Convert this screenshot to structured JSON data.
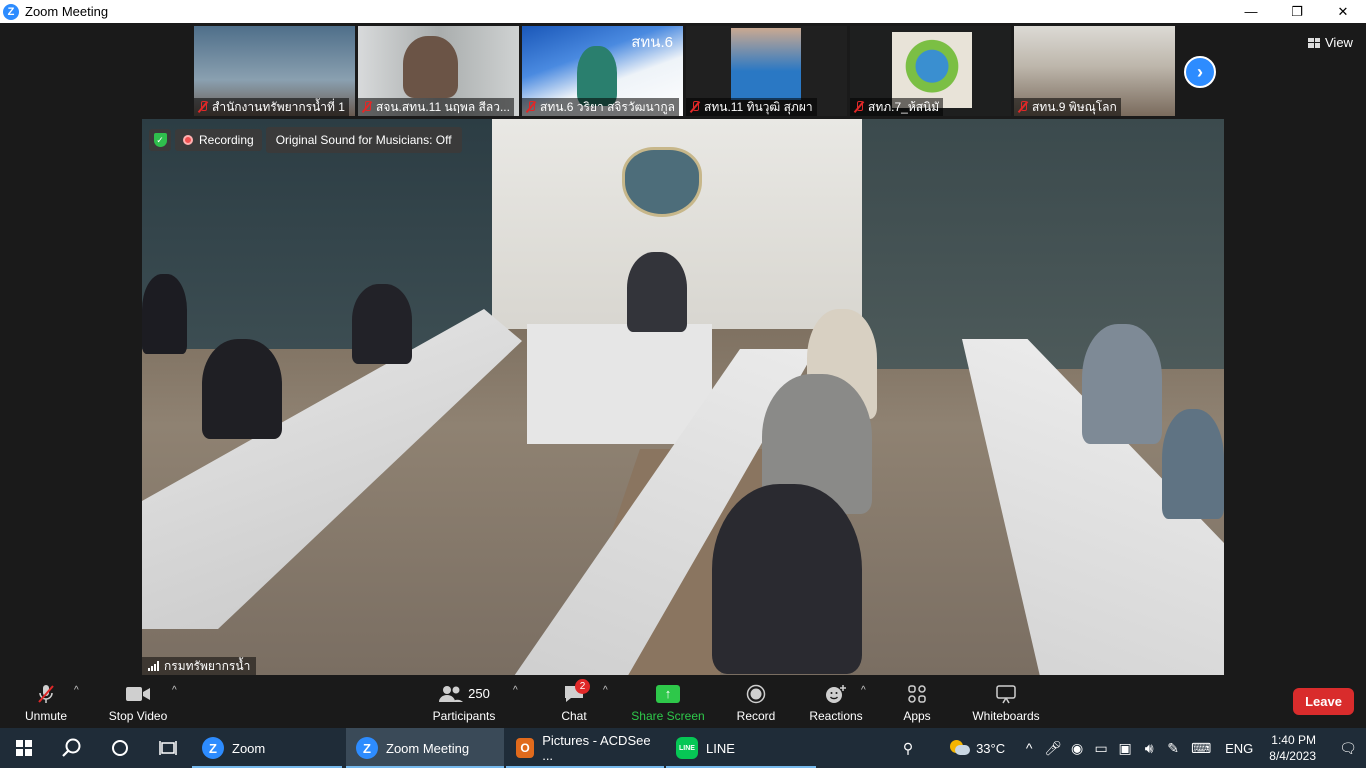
{
  "window": {
    "title": "Zoom Meeting",
    "app_logo": "Z",
    "minimize": "—",
    "maximize": "❐",
    "close": "✕"
  },
  "view_label": "View",
  "thumbnails": [
    {
      "name": "สำนักงานทรัพยากรน้ำที่ 1",
      "bg": "#6f8aa0"
    },
    {
      "name": "สจน.สทน.11 นฤพล สีลว...",
      "bg": "#b8bcbc"
    },
    {
      "name": "สทน.6 วริยา สจิรวัฒนากูล",
      "bg": "#dfe8f0",
      "overlay": "สทน.6"
    },
    {
      "name": "สทน.11 ทินวุฒิ สุภผา",
      "bg": "#2c2c2c"
    },
    {
      "name": "สทภ.7_ห้สนิมั",
      "bg": "#1e2020"
    },
    {
      "name": "สทน.9 พิษณุโลก",
      "bg": "#8c7d6f"
    }
  ],
  "recording": {
    "label": "Recording",
    "original_sound": "Original Sound for Musicians: Off"
  },
  "speaker": "กรมทรัพยากรน้ำ",
  "toolbar": {
    "unmute": "Unmute",
    "stop_video": "Stop Video",
    "participants": "Participants",
    "participants_count": "250",
    "chat": "Chat",
    "chat_badge": "2",
    "share_screen": "Share Screen",
    "record": "Record",
    "reactions": "Reactions",
    "apps": "Apps",
    "whiteboards": "Whiteboards",
    "leave": "Leave"
  },
  "taskbar": {
    "apps": [
      {
        "label": "Zoom"
      },
      {
        "label": "Zoom Meeting"
      },
      {
        "label": "Pictures - ACDSee ..."
      },
      {
        "label": "LINE"
      }
    ],
    "temperature": "33°C",
    "language": "ENG",
    "time": "1:40 PM",
    "date": "8/4/2023"
  },
  "colors": {
    "accent": "#2d8cff",
    "share_green": "#2ec84a",
    "leave_red": "#d92c2c"
  }
}
